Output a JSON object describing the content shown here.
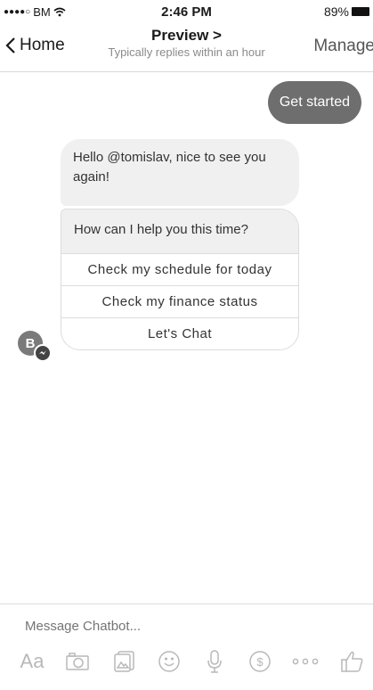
{
  "status_bar": {
    "carrier": "BM",
    "time": "2:46 PM",
    "battery": "89%"
  },
  "nav": {
    "back_label": "Home",
    "title": "Preview",
    "title_chevron": ">",
    "subtitle": "Typically replies within an hour",
    "manage_label": "Manage"
  },
  "chat": {
    "sent_message": "Get started",
    "bot_messages": [
      "Hello @tomislav, nice to see you again!",
      "How can I help you this time?"
    ],
    "quick_replies": [
      "Check my schedule for today",
      "Check my finance status",
      "Let's Chat"
    ],
    "avatar_letter": "B"
  },
  "composer": {
    "placeholder": "Message Chatbot...",
    "text_icon_label": "Aa",
    "tools": [
      "camera-icon",
      "gallery-icon",
      "emoji-icon",
      "microphone-icon",
      "payment-icon",
      "more-icon",
      "thumbs-up-icon"
    ]
  },
  "colors": {
    "sent_bubble": "#6e6e6e",
    "received_bubble": "#f0f0f0",
    "toolbar_icon": "#b8b8b8"
  }
}
